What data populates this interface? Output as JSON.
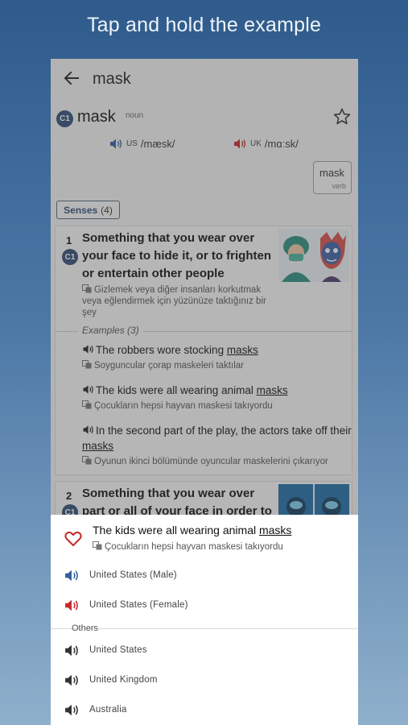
{
  "promo": {
    "title": "Tap and hold the example"
  },
  "appbar": {
    "title": "mask"
  },
  "entry": {
    "level": "C1",
    "headword": "mask",
    "pos": "noun",
    "us_label": "US",
    "us_ipa": "/mæsk/",
    "uk_label": "UK",
    "uk_ipa": "/mɑːsk/",
    "related": {
      "word": "mask",
      "pos": "verb"
    },
    "senses_label": "Senses",
    "senses_count": "(4)"
  },
  "sense1": {
    "number": "1",
    "level": "C1",
    "definition": "Something that you wear over your face to hide it, or to frighten or entertain other people",
    "translation": "Gizlemek veya diğer insanları korkutmak veya eğlendirmek için yüzünüze taktığınız bir şey",
    "examples_label": "Examples",
    "examples_count": "(3)",
    "examples": [
      {
        "pre": "The robbers wore stocking ",
        "word": "masks",
        "post": "",
        "translation": "Soyguncular çorap maskeleri taktılar"
      },
      {
        "pre": "The kids were all wearing animal ",
        "word": "masks",
        "post": "",
        "translation": "Çocukların hepsi hayvan maskesi takıyordu"
      },
      {
        "pre": "In the second part of the play, the actors take off their ",
        "word": "masks",
        "post": "",
        "translation": "Oyunun ikinci bölümünde oyuncular maskelerini çıkarıyor"
      }
    ]
  },
  "sense2": {
    "number": "2",
    "level": "C1",
    "definition": "Something that you wear over part or all of your face in order to"
  },
  "sheet": {
    "example_pre": "The kids were all wearing animal ",
    "example_word": "masks",
    "example_translation": "Çocukların hepsi hayvan maskesi takıyordu",
    "options": [
      {
        "label": "United States (Male)",
        "color": "#2f5f9e"
      },
      {
        "label": "United States (Female)",
        "color": "#c62828"
      }
    ],
    "others_label": "Others",
    "others": [
      {
        "label": "United States"
      },
      {
        "label": "United Kingdom"
      },
      {
        "label": "Australia"
      }
    ]
  },
  "colors": {
    "accent_blue": "#2f4d78",
    "speaker_us": "#2f5f9e",
    "speaker_uk": "#c62828",
    "heart": "#c62828"
  }
}
